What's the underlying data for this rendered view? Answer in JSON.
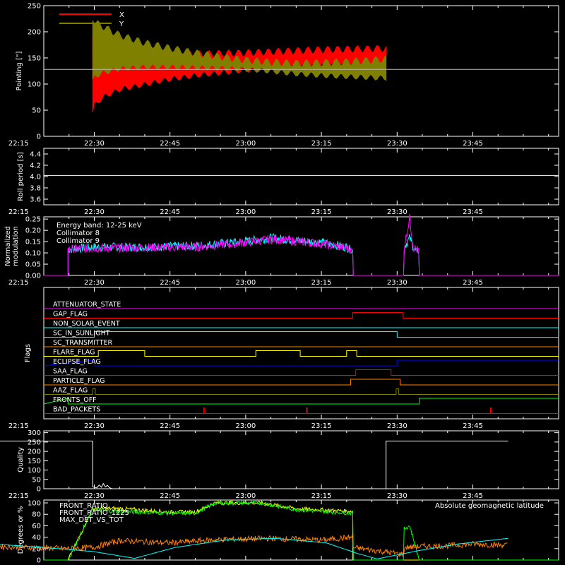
{
  "time_axis": {
    "range": [
      "22:10",
      "23:52"
    ],
    "tick_labels": [
      "22:15",
      "22:30",
      "22:45",
      "23:00",
      "23:15",
      "23:30",
      "23:45"
    ],
    "tick_minutes": [
      5,
      20,
      35,
      50,
      65,
      80,
      95
    ]
  },
  "chart_data": [
    {
      "type": "line",
      "id": "pointing",
      "ylabel": "Pointing [\"]",
      "ylim": [
        0,
        250
      ],
      "ytick_labels": [
        "0",
        "50",
        "100",
        "150",
        "200",
        "250"
      ],
      "grid": false,
      "legend": "top-left",
      "reference_line": 128,
      "series": [
        {
          "name": "X",
          "color": "#ff0000",
          "x_minutes": [
            19.7,
            20,
            22,
            25,
            30,
            35,
            40,
            45,
            50,
            55,
            60,
            65,
            70,
            75,
            77.8
          ],
          "upper": [
            200,
            185,
            180,
            172,
            168,
            166,
            164,
            165,
            166,
            168,
            170,
            172,
            173,
            174,
            174
          ],
          "lower": [
            40,
            55,
            72,
            85,
            95,
            105,
            112,
            117,
            122,
            126,
            128,
            130,
            131,
            132,
            132
          ]
        },
        {
          "name": "Y",
          "color": "#808000",
          "x_minutes": [
            19.7,
            20,
            22,
            25,
            30,
            35,
            40,
            45,
            50,
            55,
            60,
            65,
            70,
            75,
            77.8
          ],
          "upper": [
            235,
            225,
            215,
            200,
            185,
            175,
            166,
            158,
            152,
            148,
            146,
            147,
            149,
            152,
            154
          ],
          "lower": [
            100,
            110,
            118,
            125,
            128,
            128,
            127,
            126,
            124,
            120,
            115,
            112,
            110,
            108,
            107
          ]
        }
      ]
    },
    {
      "type": "line",
      "id": "roll",
      "ylabel": "Roll period [s]",
      "ylim": [
        3.5,
        4.5
      ],
      "ytick_labels": [
        "3.6",
        "3.8",
        "4.0",
        "4.2",
        "4.4"
      ],
      "series": [
        {
          "name": "",
          "color": "#ffffff",
          "x": [
            0,
            102
          ],
          "y": [
            4.02,
            4.02
          ]
        }
      ]
    },
    {
      "type": "line",
      "id": "modulation",
      "ylabel": "Normalized modulation",
      "ylim": [
        0,
        0.26
      ],
      "ytick_labels": [
        "0.00",
        "0.05",
        "0.10",
        "0.15",
        "0.20",
        "0.25"
      ],
      "annotation": "Energy band: 12-25 keV",
      "series": [
        {
          "name": "Collimator 8",
          "color": "#00ffff",
          "x_minutes": [
            14.8,
            20,
            30,
            40,
            50,
            55,
            60,
            65,
            70,
            71.2,
            81.4,
            82.5,
            83.2,
            84.4
          ],
          "y": [
            0.11,
            0.12,
            0.12,
            0.125,
            0.145,
            0.16,
            0.15,
            0.14,
            0.12,
            0.1,
            0.12,
            0.16,
            0.12,
            0.08
          ]
        },
        {
          "name": "Collimator 9",
          "color": "#ff00ff",
          "x_minutes": [
            14.8,
            20,
            30,
            40,
            50,
            55,
            60,
            65,
            70,
            71.2,
            81.4,
            82.5,
            83.2,
            84.4
          ],
          "y": [
            0.11,
            0.115,
            0.118,
            0.12,
            0.14,
            0.155,
            0.145,
            0.135,
            0.115,
            0.1,
            0.12,
            0.25,
            0.12,
            0.1
          ]
        }
      ]
    },
    {
      "type": "line",
      "id": "flags",
      "ylabel": "Flags",
      "flags": [
        {
          "name": "ATTENUATOR_STATE",
          "color": "#ff00ff",
          "x": [],
          "y": []
        },
        {
          "name": "GAP_FLAG",
          "color": "#ff0000",
          "x": [
            71.2,
            71.2,
            81.2,
            81.2
          ],
          "y": [
            0,
            1,
            1,
            0
          ]
        },
        {
          "name": "NON_SOLAR_EVENT",
          "color": "#00ffff",
          "x": [],
          "y": []
        },
        {
          "name": "SC_IN_SUNLIGHT",
          "color": "#00ffff",
          "x": [
            20,
            20,
            80,
            80
          ],
          "y": [
            0,
            1,
            1,
            0
          ]
        },
        {
          "name": "SC_TRANSMITTER",
          "color": "#ff8000",
          "x": [],
          "y": []
        },
        {
          "name": "FLARE_FLAG",
          "color": "#ffff00",
          "x": [
            20.8,
            20.8,
            30,
            30,
            52,
            52,
            60.8,
            60.8,
            70,
            70,
            72,
            72
          ],
          "y": [
            0,
            1,
            1,
            0,
            0,
            1,
            1,
            0,
            0,
            1,
            1,
            0
          ]
        },
        {
          "name": "ECLIPSE_FLAG",
          "color": "#0000ff",
          "x": [
            20,
            20,
            80,
            80
          ],
          "y": [
            1,
            0,
            0,
            1
          ]
        },
        {
          "name": "SAA_FLAG",
          "color": "#ff0000",
          "x": [
            71.8,
            71.8,
            78.8,
            78.8
          ],
          "y": [
            0,
            1,
            1,
            0
          ]
        },
        {
          "name": "PARTICLE_FLAG",
          "color": "#ff8000",
          "x": [
            70.8,
            70.8,
            80.6,
            80.6
          ],
          "y": [
            0,
            1,
            1,
            0
          ]
        },
        {
          "name": "AAZ_FLAG",
          "color": "#808000",
          "x": [
            19.7,
            19.7,
            20.2,
            20.2,
            79.8,
            79.8,
            80.3,
            80.3
          ],
          "y": [
            0,
            1,
            1,
            0,
            0,
            1,
            1,
            0
          ]
        },
        {
          "name": "FRONTS_OFF",
          "color": "#00ff00",
          "x": [
            14.8,
            14.8,
            84.4,
            84.4
          ],
          "y": [
            1,
            0,
            0,
            1
          ]
        },
        {
          "name": "BAD_PACKETS",
          "color": "#ff0000",
          "x": [
            41.7,
            41.7,
            41.9,
            41.9,
            62,
            62,
            62.2,
            62.2,
            98.5,
            98.5,
            98.7,
            98.7
          ],
          "y": [
            0,
            1,
            1,
            0,
            0,
            1,
            1,
            0,
            0,
            1,
            1,
            0
          ]
        }
      ]
    },
    {
      "type": "line",
      "id": "quality",
      "ylabel": "Quality",
      "ylim": [
        0,
        310
      ],
      "ytick_labels": [
        "0",
        "50",
        "100",
        "150",
        "200",
        "250",
        "300"
      ],
      "series": [
        {
          "name": "",
          "color": "#ffffff",
          "x": [
            0,
            19.7,
            19.7,
            20.5,
            21,
            21.4,
            21.8,
            22.2,
            22.6,
            23,
            23.5,
            77.8,
            77.8,
            102
          ],
          "y": [
            255,
            255,
            10,
            5,
            20,
            8,
            28,
            10,
            18,
            6,
            0,
            0,
            255,
            255
          ]
        }
      ]
    },
    {
      "type": "line",
      "id": "ratios",
      "ylabel": "Degrees or %",
      "ylim": [
        0,
        105
      ],
      "ytick_labels": [
        "0",
        "20",
        "40",
        "60",
        "80",
        "100"
      ],
      "annotation": "Absolute geomagnetic latitude",
      "series": [
        {
          "name": "FRONT_RATIO",
          "color": "#ffff00",
          "x_minutes": [
            14.8,
            19.7,
            25,
            35,
            40,
            44,
            53,
            60,
            71.2
          ],
          "y": [
            0,
            90,
            90,
            84,
            84,
            100,
            100,
            90,
            85
          ]
        },
        {
          "name": "FRONT_RATIO_1225",
          "color": "#00ff00",
          "x_minutes": [
            14.8,
            19.7,
            25,
            35,
            40,
            44,
            53,
            60,
            71.2,
            81.4,
            82.5,
            84.4
          ],
          "y": [
            0,
            88,
            85,
            82,
            82,
            100,
            100,
            88,
            82,
            55,
            60,
            0
          ]
        },
        {
          "name": "MAX_DET_VS_TOT",
          "color": "#ff8000",
          "x_minutes": [
            0,
            14.8,
            19.7,
            25,
            35,
            45,
            55,
            65,
            71.2,
            81.4,
            85,
            90,
            95,
            102
          ],
          "y": [
            24,
            20,
            22,
            34,
            30,
            36,
            38,
            35,
            40,
            22,
            24,
            25,
            28,
            26
          ]
        },
        {
          "name": "",
          "color": "#00ffff",
          "x_minutes": [
            0,
            10,
            19.7,
            28,
            36,
            46,
            56,
            66,
            72,
            76,
            84,
            92,
            102
          ],
          "y": [
            28,
            22,
            15,
            3,
            22,
            35,
            38,
            30,
            12,
            2,
            16,
            28,
            38
          ]
        }
      ]
    }
  ]
}
